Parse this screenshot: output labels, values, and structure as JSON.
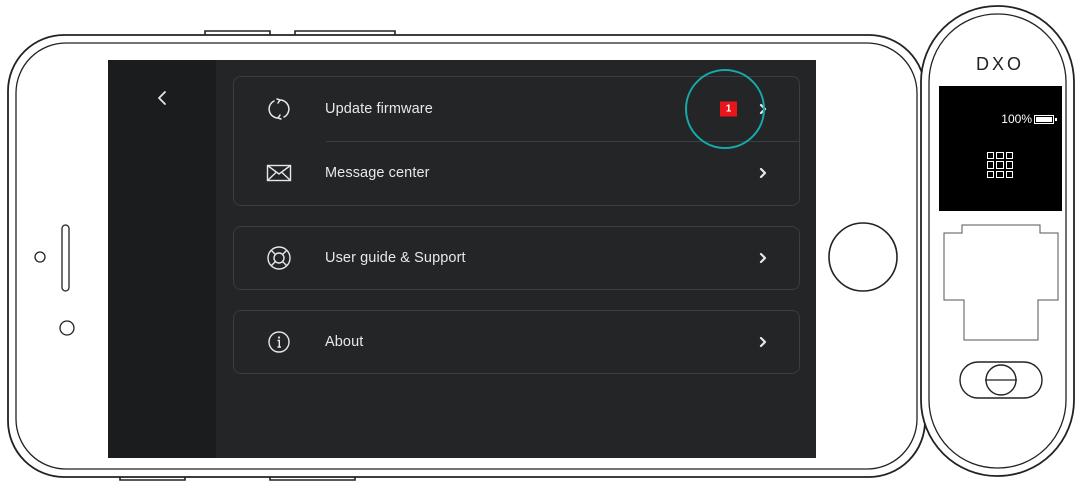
{
  "screen": {
    "back_icon": "chevron-left-icon",
    "menu": {
      "update_firmware": {
        "label": "Update firmware",
        "icon": "sync-icon",
        "badge": "1"
      },
      "message_center": {
        "label": "Message center",
        "icon": "envelope-icon"
      },
      "user_guide": {
        "label": "User guide & Support",
        "icon": "lifebuoy-icon"
      },
      "about": {
        "label": "About",
        "icon": "info-icon"
      }
    },
    "colors": {
      "background": "#232527",
      "sidebar": "#1b1c1e",
      "badge": "#e8151b",
      "highlight": "#17a9a9"
    }
  },
  "device": {
    "logo": "DXO",
    "battery": "100%",
    "grid_icon": "grid-icon"
  }
}
